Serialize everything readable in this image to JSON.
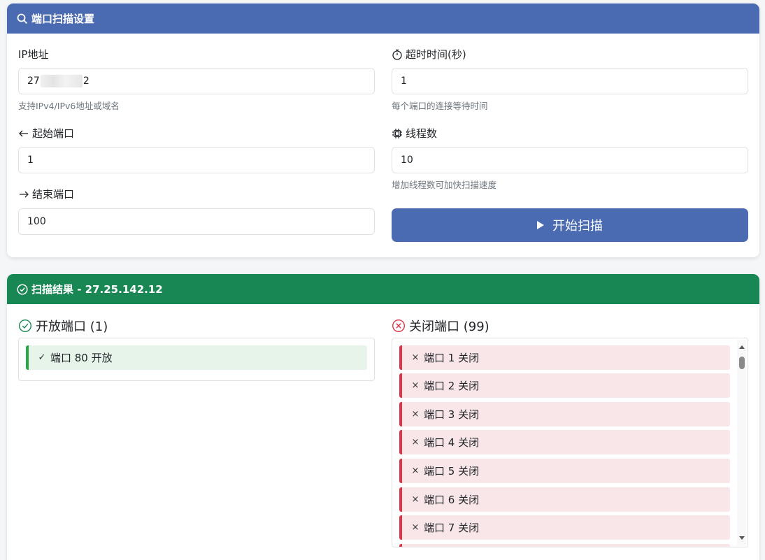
{
  "settings": {
    "title": "端口扫描设置",
    "ip_label": "IP地址",
    "ip_value_prefix": "27",
    "ip_value_suffix": "2",
    "ip_hint": "支持IPv4/IPv6地址或域名",
    "timeout_label": "超时时间(秒)",
    "timeout_value": "1",
    "timeout_hint": "每个端口的连接等待时间",
    "start_port_label": "起始端口",
    "start_port_value": "1",
    "threads_label": "线程数",
    "threads_value": "10",
    "threads_hint": "增加线程数可加快扫描速度",
    "end_port_label": "结束端口",
    "end_port_value": "100",
    "scan_button_label": "开始扫描"
  },
  "results": {
    "title": "扫描结果 - 27.25.142.12",
    "open_title": "开放端口 (1)",
    "open_items": [
      "端口 80 开放"
    ],
    "closed_title": "关闭端口 (99)",
    "closed_items": [
      "端口 1 关闭",
      "端口 2 关闭",
      "端口 3 关闭",
      "端口 4 关闭",
      "端口 5 关闭",
      "端口 6 关闭",
      "端口 7 关闭"
    ]
  },
  "icons": {
    "header_search": "search-icon",
    "timeout": "stopwatch-icon",
    "start_port": "arrow-left-icon",
    "threads": "cpu-icon",
    "end_port": "arrow-right-icon",
    "scan": "play-icon",
    "results_header": "check-circle-icon",
    "open": "check-circle-icon",
    "closed": "x-circle-icon",
    "open_item": "check-icon",
    "closed_item": "x-icon"
  },
  "colors": {
    "primary": "#4a6ab1",
    "success": "#198754",
    "success_light": "#28a745",
    "danger": "#dc3545",
    "open_bg": "#e6f4ea",
    "closed_bg": "#f9e6e8"
  }
}
